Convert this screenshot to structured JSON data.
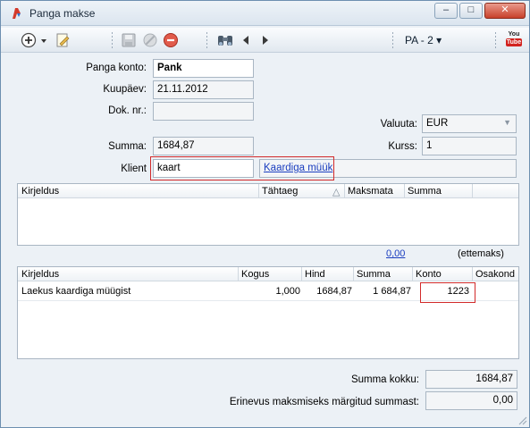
{
  "window": {
    "title": "Panga makse",
    "buttons": {
      "minimize": "–",
      "maximize": "□",
      "close": "✕"
    }
  },
  "toolbar": {
    "pa_label": "PA - 2 ▾",
    "youtube_top": "You",
    "youtube_bottom": "Tube"
  },
  "form": {
    "panga_konto": {
      "label": "Panga konto:",
      "value": "Pank"
    },
    "kuupaev": {
      "label": "Kuupäev:",
      "value": "21.11.2012"
    },
    "dok_nr": {
      "label": "Dok. nr.:",
      "value": ""
    },
    "valuuta": {
      "label": "Valuuta:",
      "value": "EUR"
    },
    "summa": {
      "label": "Summa:",
      "value": "1684,87"
    },
    "kurss": {
      "label": "Kurss:",
      "value": "1"
    },
    "klient": {
      "label": "Klient",
      "value": "kaart",
      "link": "Kaardiga müük"
    }
  },
  "invoice_grid": {
    "columns": [
      "Kirjeldus",
      "Tähtaeg",
      "Maksmata",
      "Summa"
    ],
    "sort_indicator": "△",
    "total_value": "0,00",
    "total_label": "(ettemaks)"
  },
  "lines_grid": {
    "columns": [
      "Kirjeldus",
      "Kogus",
      "Hind",
      "Summa",
      "Konto",
      "Osakond"
    ],
    "rows": [
      {
        "kirjeldus": "Laekus kaardiga müügist",
        "kogus": "1,000",
        "hind": "1684,87",
        "summa": "1 684,87",
        "konto": "1223",
        "osakond": ""
      }
    ]
  },
  "footer": {
    "summa_kokku": {
      "label": "Summa kokku:",
      "value": "1684,87"
    },
    "erinevus": {
      "label": "Erinevus maksmiseks märgitud summast:",
      "value": "0,00"
    }
  }
}
